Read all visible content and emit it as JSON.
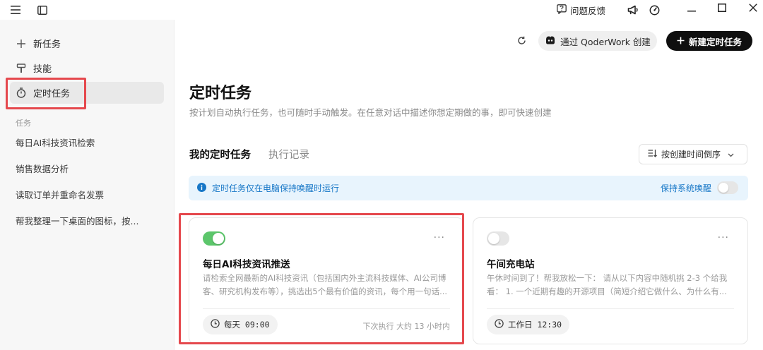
{
  "titlebar": {
    "feedback_label": "问题反馈",
    "icons": [
      "menu-icon",
      "sidebar-toggle-icon",
      "feedback-icon",
      "megaphone-icon",
      "gauge-icon",
      "minimize-icon",
      "maximize-icon",
      "close-icon"
    ]
  },
  "sidebar": {
    "nav": [
      {
        "label": "新任务",
        "icon": "plus-icon"
      },
      {
        "label": "技能",
        "icon": "brush-icon"
      },
      {
        "label": "定时任务",
        "icon": "timer-icon",
        "active": true
      }
    ],
    "section_label": "任务",
    "tasks": [
      "每日AI科技资讯检索",
      "销售数据分析",
      "读取订单并重命名发票",
      "帮我整理一下桌面的图标，按..."
    ]
  },
  "header": {
    "qoder_label": "通过 QoderWork 创建",
    "new_label": "新建定时任务"
  },
  "page": {
    "title": "定时任务",
    "subtitle": "按计划自动执行任务，也可随时手动触发。在任意对话中描述你想定期做的事，即可快速创建"
  },
  "tabs": {
    "mine": "我的定时任务",
    "history": "执行记录"
  },
  "sort": {
    "label": "按创建时间倒序"
  },
  "info": {
    "text": "定时任务仅在电脑保持唤醒时运行",
    "keep_awake_label": "保持系统唤醒",
    "keep_awake_on": false
  },
  "cards": [
    {
      "enabled": true,
      "title": "每日AI科技资讯推送",
      "desc": "请检索全网最新的AI科技资讯（包括国内外主流科技媒体、AI公司博客、研究机构发布等），挑选出5个最有价值的资讯，每个用一句话...",
      "schedule": "每天 09:00",
      "next_run": "下次执行 大约 13 小时内"
    },
    {
      "enabled": false,
      "title": "午间充电站",
      "desc": "午休时间到了！帮我放松一下： 请从以下内容中随机挑 2-3 个给我看： 1. 一个近期有趣的开源项目（简短介绍它做什么、为什么有...",
      "schedule": "工作日 12:30",
      "next_run": ""
    }
  ],
  "colors": {
    "accent_dark": "#0f0f0f",
    "toggle_on": "#5cc66b",
    "toggle_off": "#e6e6e6",
    "info_blue": "#1777c7",
    "info_bg": "#e8f4fd",
    "highlight_red": "#e5484d"
  }
}
